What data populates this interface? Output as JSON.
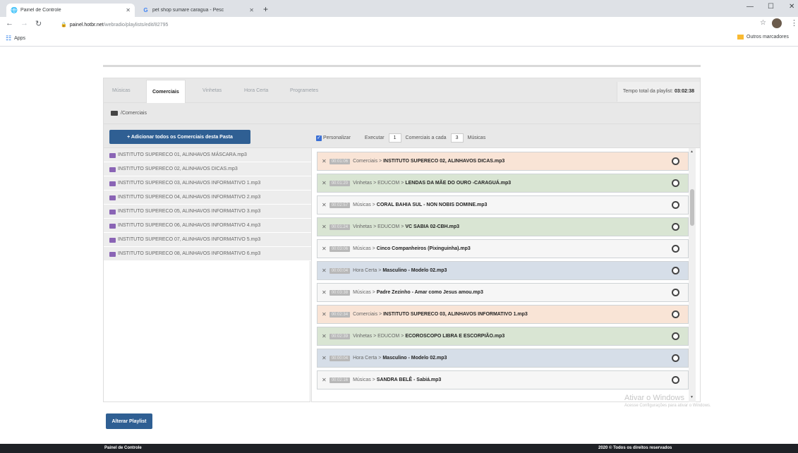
{
  "browser": {
    "tabs": [
      {
        "title": "Painel de Controle",
        "active": true
      },
      {
        "title": "pet shop sumare caragua - Pesc",
        "active": false
      }
    ],
    "url_host": "painel.hotbr.net",
    "url_path": "/webradio/playlists/edit/82795",
    "apps_label": "Apps",
    "other_bookmarks": "Outros marcadores"
  },
  "tabs": [
    "Músicas",
    "Comerciais",
    "Vinhetas",
    "Hora Certa",
    "Programetes"
  ],
  "active_tab": "Comerciais",
  "total_label": "Tempo total da playlist:",
  "total_value": "03:02:38",
  "breadcrumb": "/Comerciais",
  "add_all_button": "+ Adicionar todos os Comerciais desta Pasta",
  "personalizar": {
    "label": "Personalizar",
    "executar": "Executar",
    "exec_value": "1",
    "commercials_label": "Comerciais a cada",
    "every_value": "3",
    "musicas": "Músicas"
  },
  "left_items": [
    "INSTITUTO SUPERECO 01, ALINHAVOS MÁSCARA.mp3",
    "INSTITUTO SUPERECO 02, ALINHAVOS DICAS.mp3",
    "INSTITUTO SUPERECO 03, ALINHAVOS INFORMATIVO 1.mp3",
    "INSTITUTO SUPERECO 04, ALINHAVOS INFORMATIVO 2.mp3",
    "INSTITUTO SUPERECO 05, ALINHAVOS INFORMATIVO 3.mp3",
    "INSTITUTO SUPERECO 06, ALINHAVOS INFORMATIVO 4.mp3",
    "INSTITUTO SUPERECO 07, ALINHAVOS INFORMATIVO 5.mp3",
    "INSTITUTO SUPERECO 08, ALINHAVOS INFORMATIVO 6.mp3"
  ],
  "playlist": [
    {
      "dur": "00:01:06",
      "cat": "Comerciais >",
      "name": "INSTITUTO SUPERECO 02, ALINHAVOS DICAS.mp3",
      "color": "orange"
    },
    {
      "dur": "00:01:20",
      "cat": "Vinhetas > EDUCOM >",
      "name": "LENDAS DA MÃE DO OURO -CARAGUÁ.mp3",
      "color": "green"
    },
    {
      "dur": "00:02:57",
      "cat": "Músicas >",
      "name": "CORAL BAHIA SUL - NON NOBIS DOMINE.mp3",
      "color": "white"
    },
    {
      "dur": "00:01:24",
      "cat": "Vinhetas > EDUCOM >",
      "name": "VC SABIA 02-CBH.mp3",
      "color": "green"
    },
    {
      "dur": "00:03:06",
      "cat": "Músicas >",
      "name": "Cinco Companheiros (Pixinguinha).mp3",
      "color": "white"
    },
    {
      "dur": "00:00:04",
      "cat": "Hora Certa >",
      "name": "Masculino - Modelo 02.mp3",
      "color": "blue"
    },
    {
      "dur": "00:03:38",
      "cat": "Músicas >",
      "name": "Padre Zezinho - Amar como Jesus amou.mp3",
      "color": "white"
    },
    {
      "dur": "00:02:34",
      "cat": "Comerciais >",
      "name": "INSTITUTO SUPERECO 03, ALINHAVOS INFORMATIVO 1.mp3",
      "color": "orange"
    },
    {
      "dur": "00:02:39",
      "cat": "Vinhetas > EDUCOM >",
      "name": "ECOROSCOPO LIBRA E ESCORPIÃO.mp3",
      "color": "green"
    },
    {
      "dur": "00:00:04",
      "cat": "Hora Certa >",
      "name": "Masculino - Modelo 02.mp3",
      "color": "blue"
    },
    {
      "dur": "00:02:16",
      "cat": "Músicas >",
      "name": "SANDRA BELÊ - Sabiá.mp3",
      "color": "white"
    }
  ],
  "watermark_title": "Ativar o Windows",
  "watermark_sub": "Acesse Configurações para ativar o Windows.",
  "alter_button": "Alterar Playlist",
  "footer_left": "Painel de Controle",
  "footer_right": "2020 © Todos os direitos reservados"
}
